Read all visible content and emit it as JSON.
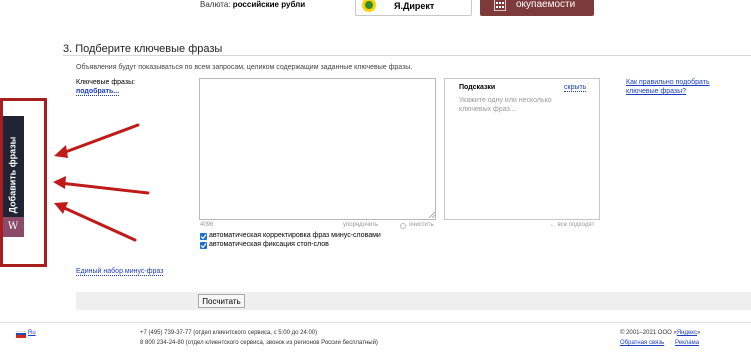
{
  "top": {
    "currency_label": "Валюта:",
    "currency_value": "российские рубли",
    "direct_button": "Я.Директ",
    "roi_button": "окупаемости"
  },
  "section": {
    "title": "3. Подберите ключевые фразы",
    "hint": "Объявления будут показываться по всем запросам, целиком содержащим заданные ключевые фразы.",
    "keywords_label": "Ключевые фразы:",
    "keywords_select_link": "подобрать...",
    "keywords_value": "",
    "char_count": "4096",
    "arrange_button": "упорядочить",
    "clean_button": "очистить",
    "all_fit": "← все подходят",
    "checkboxes": [
      {
        "label": "автоматическая корректировка фраз минус-словами",
        "checked": true
      },
      {
        "label": "автоматическая фиксация стоп-слов",
        "checked": true
      }
    ],
    "minus_words_link": "Единый набор минус-фраз",
    "calc_button": "Посчитать"
  },
  "hints": {
    "title": "Подсказки",
    "hide_link": "скрыть",
    "body": "Укажите одну или несколько ключевых фраз..."
  },
  "help_link": "Как правильно подобрать ключевые фразы?",
  "footer": {
    "lang": "Ru",
    "phone1": "+7 (495) 739-37-77 (отдел клиентского сервиса, с 5:00 до 24:00)",
    "phone2": "8 800 234-24-80 (отдел клиентского сервиса, звонок из регионов России бесплатный)",
    "copyright_prefix": "© 2001–2021 ООО «",
    "copyright_link": "Яндекс",
    "copyright_suffix": "»",
    "feedback_link": "Обратная связь",
    "separator": "·",
    "ad_link": "Реклама"
  },
  "side_widget": {
    "tab_label": "Добавить фразы",
    "badge": "W",
    "frame_color": "#a81e1e",
    "tab_color": "#1f2333",
    "badge_color": "#8a4a68"
  },
  "colors": {
    "link": "#1a3dc1",
    "roi_button": "#7d3a3a",
    "annotation": "#c11a1a"
  }
}
